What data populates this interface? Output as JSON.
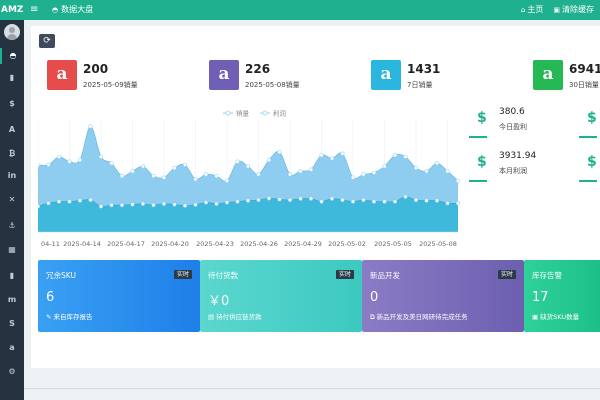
{
  "topbar": {
    "brand": "AMZS",
    "menu_icon": "menu-icon",
    "tab_label": "数据大盘",
    "home_label": "主页",
    "clear_cache_label": "清除缓存"
  },
  "colors": {
    "topbar": "#1fb18f",
    "sidebar": "#253340",
    "red": "#e74c4c",
    "purple": "#6f5fb5",
    "cyan": "#2bb6e0",
    "green": "#27b856"
  },
  "sidebar": {
    "icons": [
      {
        "name": "dashboard-icon",
        "glyph": "◓"
      },
      {
        "name": "bar-chart-icon",
        "glyph": "▮"
      },
      {
        "name": "dollar-icon",
        "glyph": "$"
      },
      {
        "name": "font-icon",
        "glyph": "A"
      },
      {
        "name": "bitcoin-icon",
        "glyph": "₿"
      },
      {
        "name": "linkedin-icon",
        "glyph": "in"
      },
      {
        "name": "shuffle-icon",
        "glyph": "✕"
      },
      {
        "name": "anchor-icon",
        "glyph": "⚓"
      },
      {
        "name": "bank-icon",
        "glyph": "▦"
      },
      {
        "name": "bar-chart-2-icon",
        "glyph": "▮"
      },
      {
        "name": "medium-icon",
        "glyph": "m"
      },
      {
        "name": "skype-icon",
        "glyph": "S"
      },
      {
        "name": "amazon-icon",
        "glyph": "a"
      },
      {
        "name": "settings-icon",
        "glyph": "⚙"
      }
    ]
  },
  "stats": [
    {
      "value": "200",
      "label": "2025-05-09销量",
      "color": "#e74c4c"
    },
    {
      "value": "226",
      "label": "2025-05-08销量",
      "color": "#6f5fb5"
    },
    {
      "value": "1431",
      "label": "7日销量",
      "color": "#2bb6e0"
    },
    {
      "value": "6941",
      "label": "30日销量",
      "color": "#27b856"
    }
  ],
  "profit_cards": [
    {
      "value": "380.6",
      "label": "今日盈利"
    },
    {
      "value": "3931.94",
      "label": "本月利润"
    }
  ],
  "cards": [
    {
      "title": "冗余SKU",
      "tag": "实时",
      "value": "6",
      "desc": "来自库存报告",
      "icon": "magic-icon",
      "glyph": "✎",
      "color": "#2b8ef0"
    },
    {
      "title": "待付货款",
      "tag": "实时",
      "value": "￥0",
      "desc": "待付供应链货款",
      "icon": "file-icon",
      "glyph": "▤",
      "color": "#4ad1c7"
    },
    {
      "title": "新品开发",
      "tag": "实时",
      "value": "0",
      "desc": "新品开发及美日网研待完成任务",
      "icon": "copy-icon",
      "glyph": "⧉",
      "color": "#7a6bb8"
    },
    {
      "title": "库存告警",
      "tag": "",
      "value": "17",
      "desc": "缺货SKU数量",
      "icon": "image-icon",
      "glyph": "▣",
      "color": "#1fc48f"
    }
  ],
  "chart_data": {
    "type": "area",
    "series": [
      {
        "name": "销量",
        "color": "#8fcdf0",
        "values": [
          210,
          210,
          235,
          220,
          225,
          330,
          235,
          215,
          175,
          190,
          205,
          175,
          170,
          200,
          210,
          165,
          180,
          175,
          160,
          220,
          205,
          180,
          225,
          250,
          180,
          190,
          195,
          240,
          230,
          245,
          170,
          180,
          185,
          205,
          240,
          235,
          200,
          190,
          215,
          190,
          160
        ]
      },
      {
        "name": "利润",
        "color": "#3fb9db",
        "values": [
          80,
          90,
          95,
          95,
          98,
          100,
          80,
          84,
          84,
          86,
          88,
          84,
          88,
          86,
          82,
          85,
          92,
          88,
          92,
          95,
          98,
          100,
          105,
          102,
          100,
          104,
          104,
          95,
          104,
          100,
          95,
          100,
          95,
          95,
          95,
          110,
          100,
          98,
          98,
          90,
          90
        ]
      }
    ],
    "x_ticks": [
      "04-11",
      "2025-04-14",
      "2025-04-17",
      "2025-04-20",
      "2025-04-23",
      "2025-04-26",
      "2025-04-29",
      "2025-05-02",
      "2025-05-05",
      "2025-05-08"
    ],
    "ylim": [
      0,
      350
    ],
    "legend_position": "top-center",
    "grid": "vertical"
  }
}
